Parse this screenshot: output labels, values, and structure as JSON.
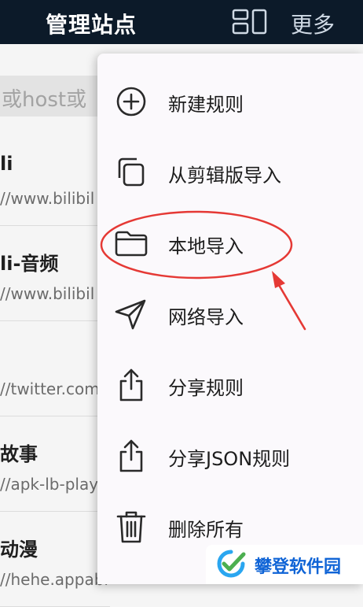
{
  "header": {
    "title": "管理站点",
    "layout_icon": "layout-grid-icon",
    "more_label": "更多"
  },
  "search": {
    "placeholder": "或host或"
  },
  "list": {
    "rows": [
      {
        "title": "li",
        "url": "//www.bilibil"
      },
      {
        "title": "li-音频",
        "url": "//www.bilibil"
      },
      {
        "title": "",
        "url": "//twitter.com"
      },
      {
        "title": "故事",
        "url": "//apk-lb-play"
      },
      {
        "title": "动漫",
        "url": "//hehe.appabi.cc"
      }
    ]
  },
  "menu": {
    "items": [
      {
        "label": "新建规则",
        "icon": "add-circle-icon"
      },
      {
        "label": "从剪辑版导入",
        "icon": "copy-icon"
      },
      {
        "label": "本地导入",
        "icon": "folder-icon"
      },
      {
        "label": "网络导入",
        "icon": "send-icon"
      },
      {
        "label": "分享规则",
        "icon": "share-icon"
      },
      {
        "label": "分享JSON规则",
        "icon": "share-icon"
      },
      {
        "label": "删除所有",
        "icon": "trash-icon"
      }
    ]
  },
  "annotation": {
    "highlight_color": "#e53935"
  },
  "watermark": {
    "text": "攀登软件园"
  }
}
